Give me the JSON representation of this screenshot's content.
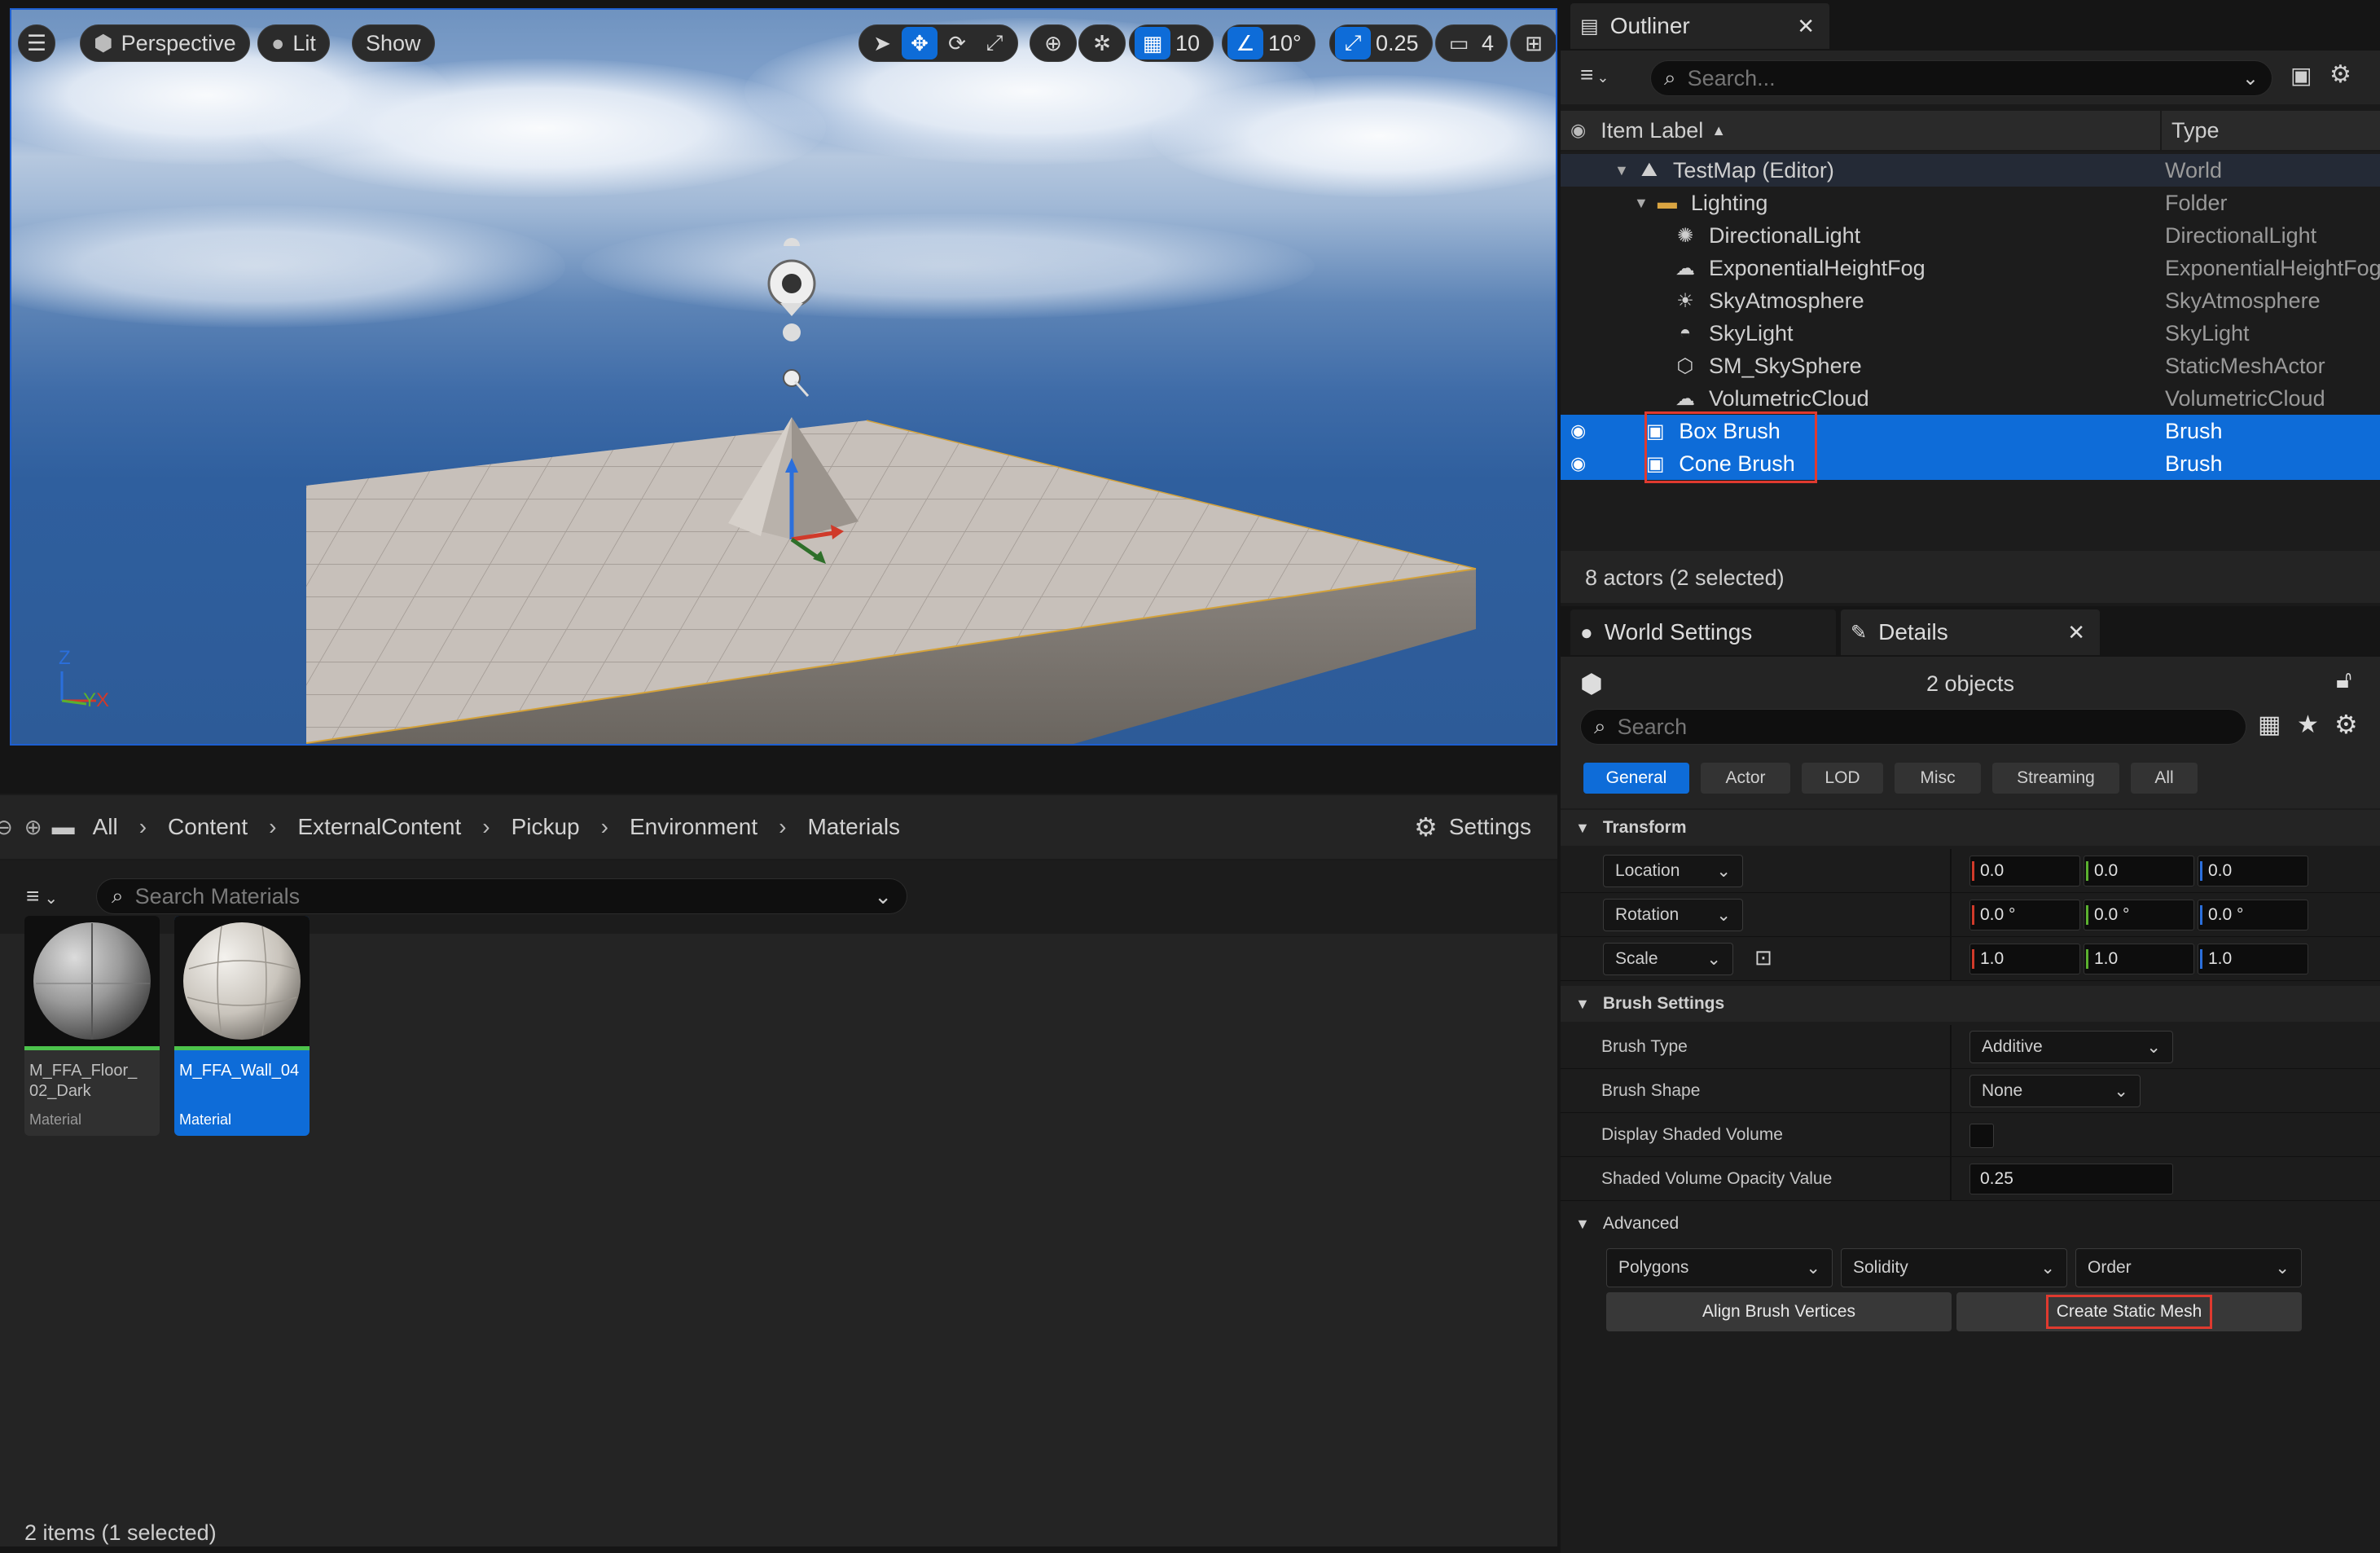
{
  "viewport": {
    "perspective_label": "Perspective",
    "lit_label": "Lit",
    "show_label": "Show",
    "grid_snap": "10",
    "rotation_snap": "10°",
    "scale_snap": "0.25",
    "camera_speed": "4",
    "axis_z": "Z",
    "axis_x": "X",
    "axis_y": "Y"
  },
  "content_browser": {
    "breadcrumb": [
      "All",
      "Content",
      "ExternalContent",
      "Pickup",
      "Environment",
      "Materials"
    ],
    "settings_label": "Settings",
    "search_placeholder": "Search Materials",
    "assets": [
      {
        "name": "M_FFA_Floor_02_Dark",
        "name_display": "M_FFA_Floor_\n02_Dark",
        "type": "Material",
        "selected": false
      },
      {
        "name": "M_FFA_Wall_04",
        "name_display": "M_FFA_Wall_04",
        "type": "Material",
        "selected": true
      }
    ],
    "status": "2 items (1 selected)"
  },
  "outliner": {
    "tab_label": "Outliner",
    "search_placeholder": "Search...",
    "col_label": "Item Label",
    "col_type": "Type",
    "rows": [
      {
        "label": "TestMap (Editor)",
        "type": "World",
        "icon": "map-icon"
      },
      {
        "label": "Lighting",
        "type": "Folder",
        "icon": "folder-icon"
      },
      {
        "label": "DirectionalLight",
        "type": "DirectionalLight",
        "icon": "sun-icon"
      },
      {
        "label": "ExponentialHeightFog",
        "type": "ExponentialHeightFog",
        "icon": "fog-icon"
      },
      {
        "label": "SkyAtmosphere",
        "type": "SkyAtmosphere",
        "icon": "atmosphere-icon"
      },
      {
        "label": "SkyLight",
        "type": "SkyLight",
        "icon": "skylight-icon"
      },
      {
        "label": "SM_SkySphere",
        "type": "StaticMeshActor",
        "icon": "mesh-icon"
      },
      {
        "label": "VolumetricCloud",
        "type": "VolumetricCloud",
        "icon": "cloud-icon"
      },
      {
        "label": "Box Brush",
        "type": "Brush",
        "icon": "brush-icon"
      },
      {
        "label": "Cone Brush",
        "type": "Brush",
        "icon": "brush-icon"
      }
    ],
    "status": "8 actors (2 selected)"
  },
  "details": {
    "world_settings_tab": "World Settings",
    "details_tab": "Details",
    "objects_label": "2 objects",
    "search_placeholder": "Search",
    "filters": [
      "General",
      "Actor",
      "LOD",
      "Misc",
      "Streaming",
      "All"
    ],
    "transform": {
      "header": "Transform",
      "location_label": "Location",
      "rotation_label": "Rotation",
      "scale_label": "Scale",
      "location": [
        "0.0",
        "0.0",
        "0.0"
      ],
      "rotation": [
        "0.0 °",
        "0.0 °",
        "0.0 °"
      ],
      "scale": [
        "1.0",
        "1.0",
        "1.0"
      ]
    },
    "brush_settings": {
      "header": "Brush Settings",
      "brush_type_label": "Brush Type",
      "brush_type_value": "Additive",
      "brush_shape_label": "Brush Shape",
      "brush_shape_value": "None",
      "display_shaded_label": "Display Shaded Volume",
      "opacity_label": "Shaded Volume Opacity Value",
      "opacity_value": "0.25"
    },
    "advanced": {
      "header": "Advanced",
      "polygons": "Polygons",
      "solidity": "Solidity",
      "order": "Order",
      "align_btn": "Align Brush Vertices",
      "create_btn": "Create Static Mesh"
    }
  },
  "colors": {
    "accent": "#0e6cd8",
    "highlight": "#e03a2f",
    "x_axis": "#d03a2a",
    "y_axis": "#5bb02f",
    "z_axis": "#2b6fdc"
  }
}
